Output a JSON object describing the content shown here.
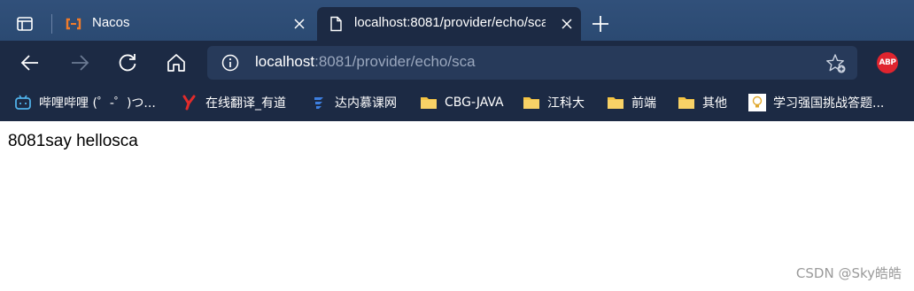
{
  "tabs": [
    {
      "title": "Nacos",
      "favicon": "alibaba-cloud-icon"
    },
    {
      "title": "localhost:8081/provider/echo/sca",
      "favicon": "page-icon"
    }
  ],
  "address_bar": {
    "host": "localhost",
    "rest": ":8081/provider/echo/sca"
  },
  "extension": {
    "label": "ABP"
  },
  "bookmarks": [
    {
      "label": "哔哩哔哩 (゜-゜)つ...",
      "icon": "bilibili-icon"
    },
    {
      "label": "在线翻译_有道",
      "icon": "youdao-icon"
    },
    {
      "label": "达内慕课网",
      "icon": "tarena-icon"
    },
    {
      "label": "CBG-JAVA",
      "icon": "folder-icon"
    },
    {
      "label": "江科大",
      "icon": "folder-icon"
    },
    {
      "label": "前端",
      "icon": "folder-icon"
    },
    {
      "label": "其他",
      "icon": "folder-icon"
    },
    {
      "label": "学习强国挑战答题...",
      "icon": "bulb-icon"
    }
  ],
  "page": {
    "body_text": "8081say hellosca"
  },
  "watermark": "CSDN @Sky皓皓",
  "colors": {
    "tab_strip": "#2f4d76",
    "toolbar": "#1c2a44",
    "omnibox": "#273a5a",
    "folder": "#f5c443",
    "abp": "#e0242e",
    "nacos_orange": "#f07b2a"
  }
}
